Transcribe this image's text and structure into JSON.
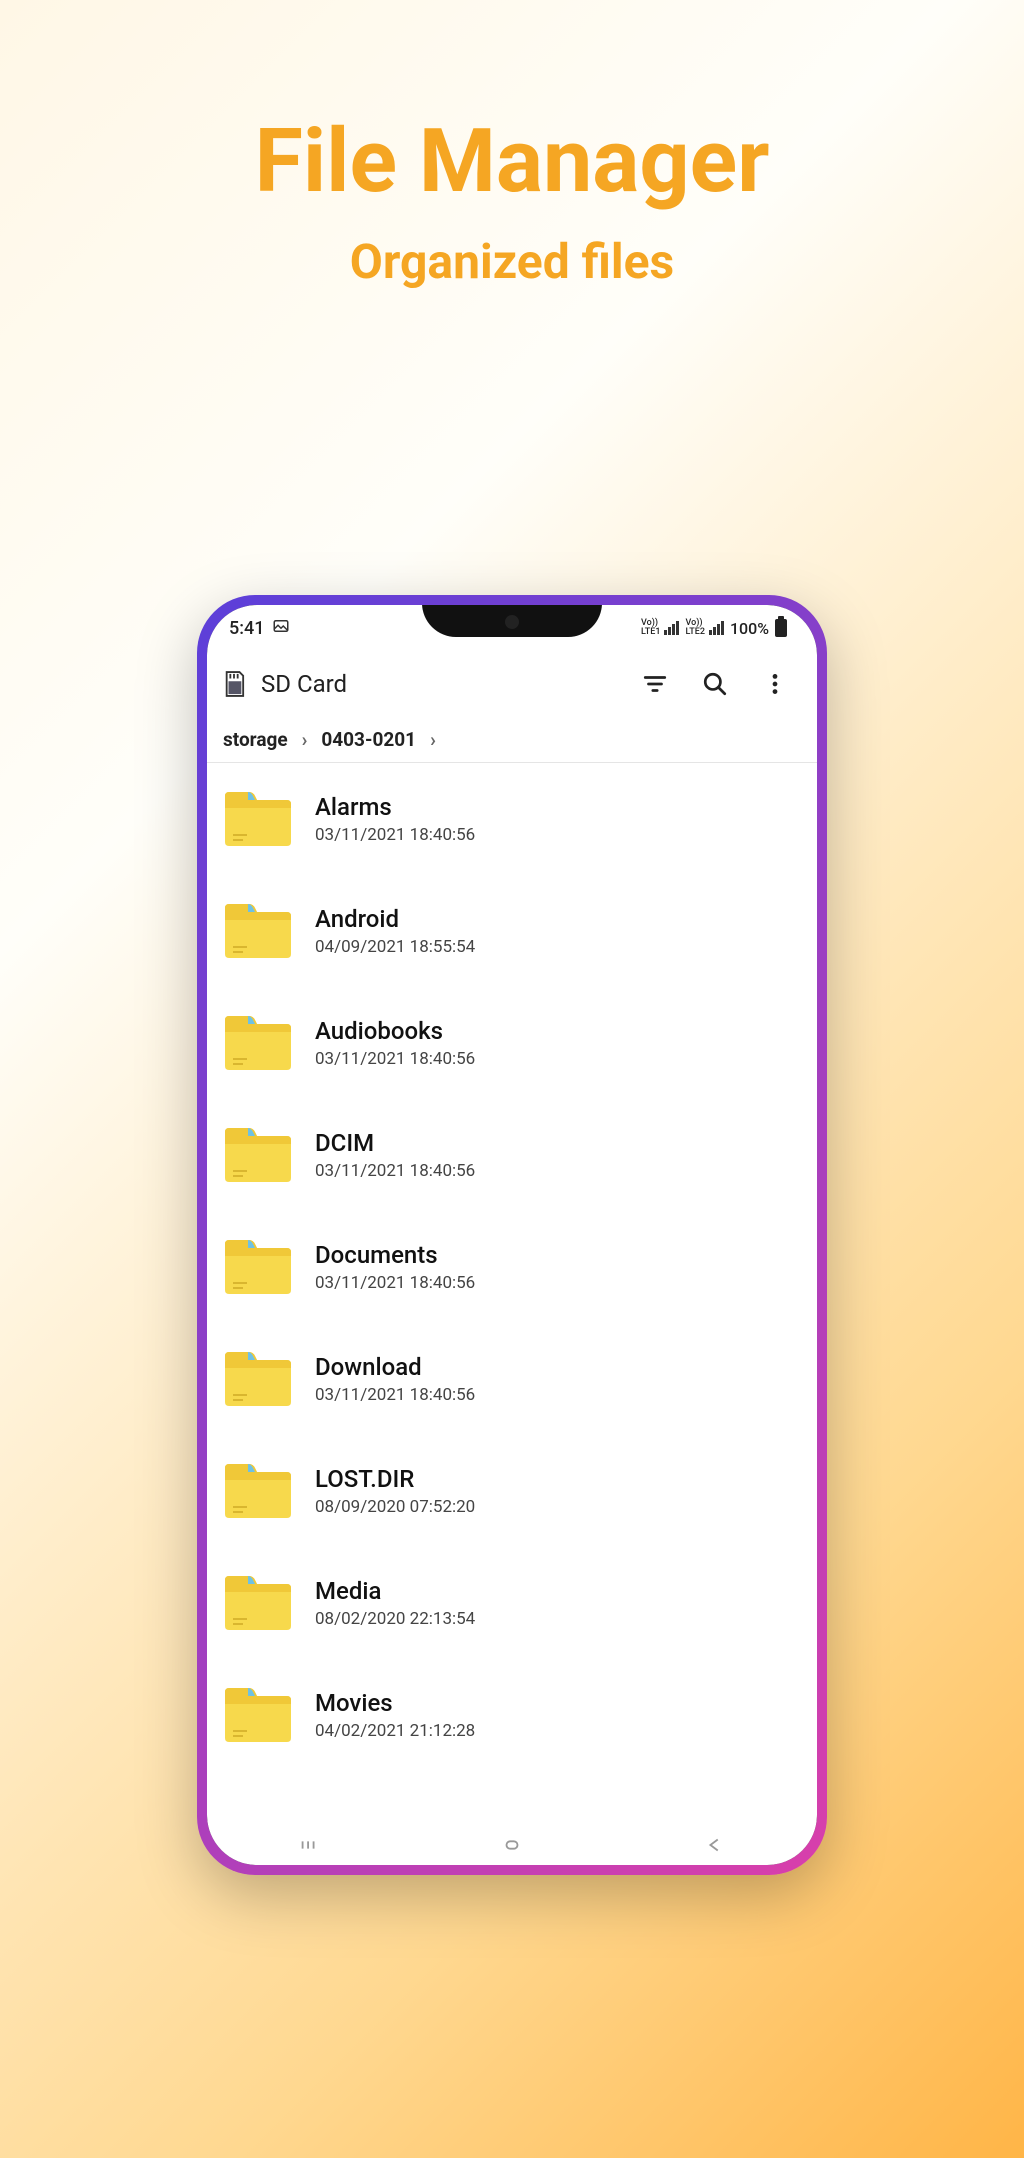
{
  "promo": {
    "title": "File Manager",
    "subtitle": "Organized files"
  },
  "statusbar": {
    "time": "5:41",
    "network1": "Vo)) LTE1",
    "network2": "Vo)) LTE2",
    "battery_pct": "100%"
  },
  "toolbar": {
    "title": "SD Card"
  },
  "breadcrumb": {
    "items": [
      "storage",
      "0403-0201"
    ]
  },
  "files": [
    {
      "name": "Alarms",
      "date": "03/11/2021 18:40:56"
    },
    {
      "name": "Android",
      "date": "04/09/2021 18:55:54"
    },
    {
      "name": "Audiobooks",
      "date": "03/11/2021 18:40:56"
    },
    {
      "name": "DCIM",
      "date": "03/11/2021 18:40:56"
    },
    {
      "name": "Documents",
      "date": "03/11/2021 18:40:56"
    },
    {
      "name": "Download",
      "date": "03/11/2021 18:40:56"
    },
    {
      "name": "LOST.DIR",
      "date": "08/09/2020 07:52:20"
    },
    {
      "name": "Media",
      "date": "08/02/2020 22:13:54"
    },
    {
      "name": "Movies",
      "date": "04/02/2021 21:12:28"
    }
  ]
}
